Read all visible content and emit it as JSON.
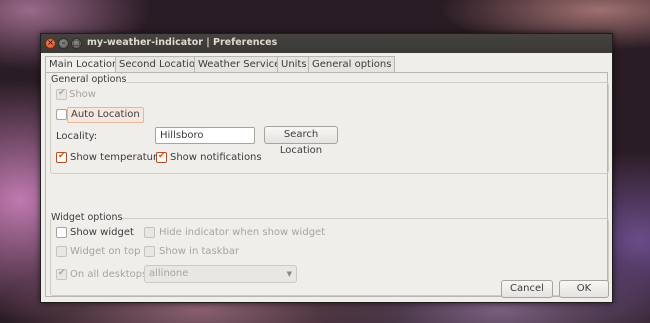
{
  "window": {
    "title": "my-weather-indicator | Preferences"
  },
  "tabs": [
    {
      "label": "Main Location",
      "active": true
    },
    {
      "label": "Second Location",
      "active": false
    },
    {
      "label": "Weather Services",
      "active": false
    },
    {
      "label": "Units",
      "active": false
    },
    {
      "label": "General options",
      "active": false
    }
  ],
  "general_options": {
    "title": "General options",
    "show": {
      "label": "Show",
      "checked": true,
      "enabled": false
    },
    "auto_location": {
      "label": "Auto Location",
      "checked": false
    },
    "locality_label": "Locality:",
    "locality_value": "Hillsboro",
    "search_button": "Search Location",
    "show_temperature": {
      "label": "Show temperature",
      "checked": true
    },
    "show_notifications": {
      "label": "Show notifications",
      "checked": true
    }
  },
  "widget_options": {
    "title": "Widget options",
    "show_widget": {
      "label": "Show widget",
      "checked": false
    },
    "hide_indicator": {
      "label": "Hide indicator when show widget",
      "checked": false,
      "enabled": false
    },
    "widget_on_top": {
      "label": "Widget on top",
      "checked": false,
      "enabled": false
    },
    "show_in_taskbar": {
      "label": "Show in taskbar",
      "checked": false,
      "enabled": false
    },
    "on_all_desktops": {
      "label": "On all desktops",
      "checked": true,
      "enabled": false
    },
    "skin_select": "allinone"
  },
  "buttons": {
    "cancel": "Cancel",
    "ok": "OK"
  },
  "colors": {
    "accent": "#d45a24",
    "window_bg": "#efeeea",
    "titlebar": "#3c3b37"
  }
}
